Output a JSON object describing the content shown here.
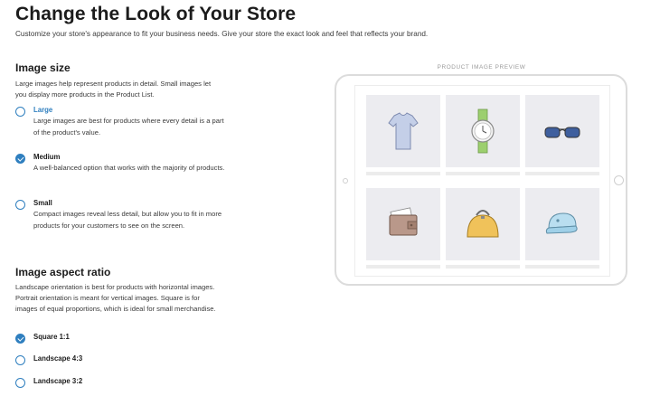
{
  "page": {
    "title": "Change the Look of Your Store",
    "subtitle": "Customize your store's appearance to fit your business needs. Give your store the exact look and feel that reflects your brand."
  },
  "image_size": {
    "title": "Image size",
    "description": "Large images help represent products in detail. Small images let you display more products in the Product List.",
    "options": [
      {
        "label": "Large",
        "checked": false,
        "description": "Large images are best for products where every detail is a part of the product's value."
      },
      {
        "label": "Medium",
        "checked": true,
        "description": "A well-balanced option that works with the majority of products."
      },
      {
        "label": "Small",
        "checked": false,
        "description": "Compact images reveal less detail, but allow you to fit in more products for your customers to see on the screen."
      }
    ]
  },
  "aspect_ratio": {
    "title": "Image aspect ratio",
    "description": "Landscape orientation is best for products with horizontal images. Portrait orientation is meant for vertical images. Square is for images of equal proportions, which is ideal for small merchandise.",
    "options": [
      {
        "label": "Square 1:1",
        "checked": true
      },
      {
        "label": "Landscape 4:3",
        "checked": false
      },
      {
        "label": "Landscape 3:2",
        "checked": false
      }
    ]
  },
  "preview": {
    "label": "PRODUCT IMAGE PREVIEW",
    "products": [
      {
        "icon": "t-shirt-icon"
      },
      {
        "icon": "watch-icon"
      },
      {
        "icon": "sunglasses-icon"
      },
      {
        "icon": "wallet-icon"
      },
      {
        "icon": "bag-icon"
      },
      {
        "icon": "cap-icon"
      }
    ]
  },
  "colors": {
    "accent": "#2f7fbf",
    "tile_background": "#ececf0"
  }
}
